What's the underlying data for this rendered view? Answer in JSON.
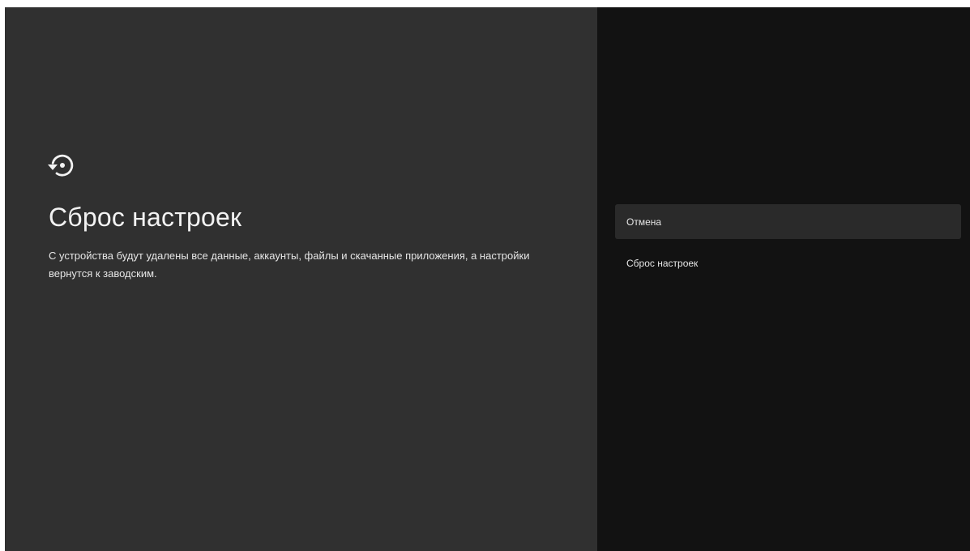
{
  "info": {
    "icon": "restore-icon",
    "title": "Сброс настроек",
    "description": "С устройства будут удалены все данные, аккаунты, файлы и скачанные приложения, а настройки вернутся к заводским."
  },
  "actions": [
    {
      "label": "Отмена",
      "focused": true
    },
    {
      "label": "Сброс настроек",
      "focused": false
    }
  ],
  "colors": {
    "left_background": "#303030",
    "right_background": "#121212",
    "focused_item": "#2a2a2a",
    "text": "#f2f2f2"
  }
}
